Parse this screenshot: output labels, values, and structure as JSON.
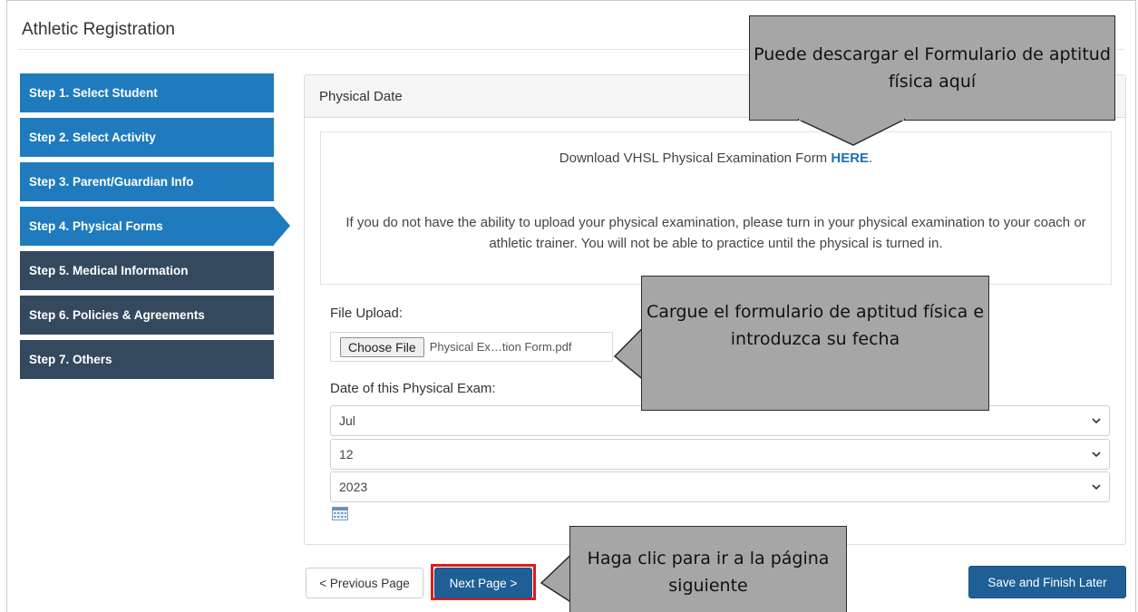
{
  "page": {
    "title": "Athletic Registration"
  },
  "steps": [
    {
      "label": "Step 1. Select Student",
      "state": "done"
    },
    {
      "label": "Step 2. Select Activity",
      "state": "done"
    },
    {
      "label": "Step 3. Parent/Guardian Info",
      "state": "done"
    },
    {
      "label": "Step 4. Physical Forms",
      "state": "active"
    },
    {
      "label": "Step 5. Medical Information",
      "state": "todo"
    },
    {
      "label": "Step 6. Policies & Agreements",
      "state": "todo"
    },
    {
      "label": "Step 7. Others",
      "state": "todo"
    }
  ],
  "panel": {
    "heading": "Physical Date",
    "download_text": "Download VHSL Physical Examination Form ",
    "download_link": "HERE",
    "download_suffix": ".",
    "warning": "If you do not have the ability to upload your physical examination, please turn in your physical examination to your coach or athletic trainer. You will not be able to practice until the physical is turned in.",
    "file_upload_label": "File Upload:",
    "choose_file_label": "Choose File",
    "file_name": "Physical Ex…tion Form.pdf",
    "date_label": "Date of this Physical Exam:",
    "month": "Jul",
    "day": "12",
    "year": "2023"
  },
  "buttons": {
    "previous": "< Previous Page",
    "next": "Next Page >",
    "save": "Save and Finish Later"
  },
  "callouts": {
    "download": "Puede descargar el Formulario de aptitud física aquí",
    "upload": "Cargue el formulario de aptitud física e introduzca su fecha",
    "next": "Haga clic para ir a la página siguiente"
  },
  "colors": {
    "step_done": "#1f7bbd",
    "step_todo": "#34495e",
    "primary_button": "#1f5f95",
    "highlight_border": "#e01b1b",
    "callout_fill": "#a6a6a6"
  }
}
